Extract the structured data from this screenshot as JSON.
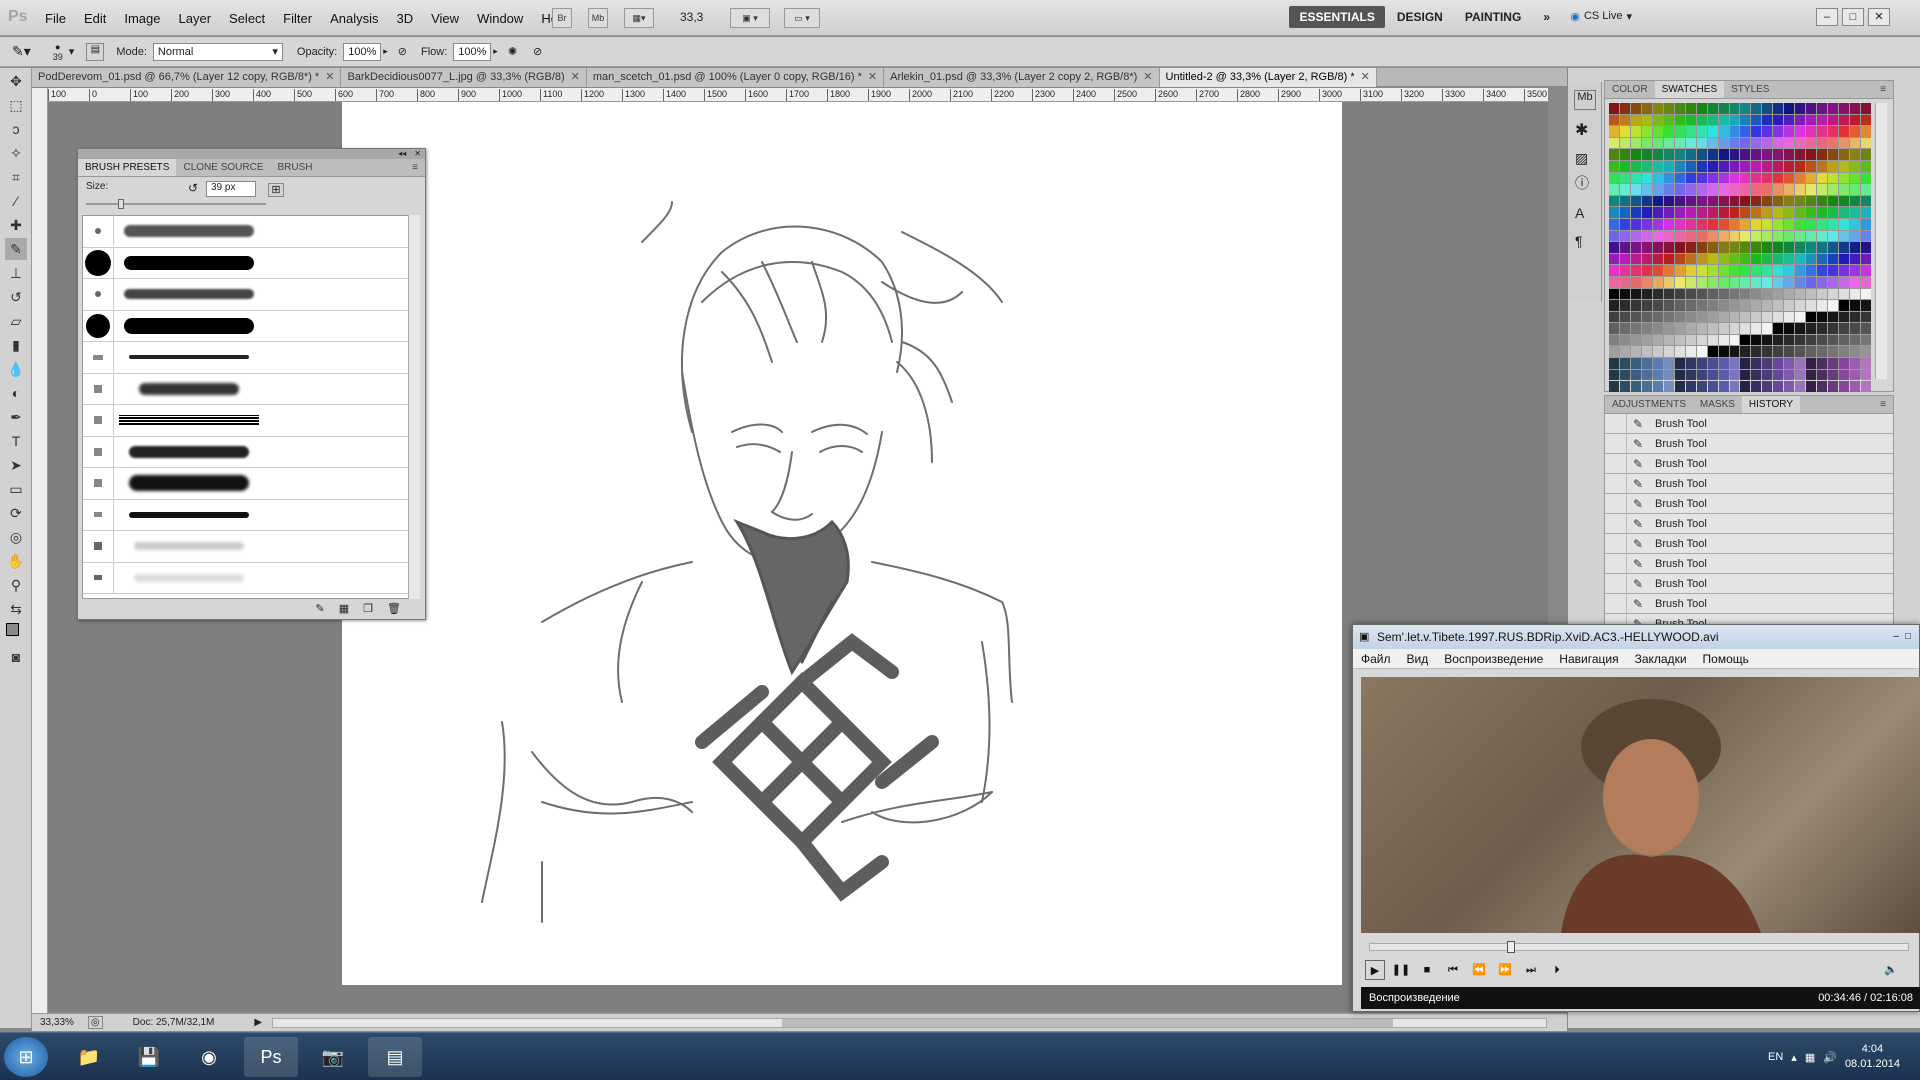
{
  "app": {
    "logo": "Ps"
  },
  "menu": [
    "File",
    "Edit",
    "Image",
    "Layer",
    "Select",
    "Filter",
    "Analysis",
    "3D",
    "View",
    "Window",
    "Help"
  ],
  "menubar_buttons": {
    "bridge": "Br",
    "minibridge": "Mb",
    "zoom": "33,3"
  },
  "workspaces": [
    "ESSENTIALS",
    "DESIGN",
    "PAINTING"
  ],
  "cs_live": "CS Live",
  "options": {
    "brush_size": "39",
    "mode_label": "Mode:",
    "mode_value": "Normal",
    "opacity_label": "Opacity:",
    "opacity_value": "100%",
    "flow_label": "Flow:",
    "flow_value": "100%"
  },
  "doc_tabs": [
    {
      "label": "PodDerevom_01.psd @ 66,7% (Layer 12 copy, RGB/8*) *"
    },
    {
      "label": "BarkDecidious0077_L.jpg @ 33,3% (RGB/8)"
    },
    {
      "label": "man_scetch_01.psd @ 100% (Layer 0 copy, RGB/16) *"
    },
    {
      "label": "Arlekin_01.psd @ 33,3% (Layer 2 copy 2, RGB/8*)"
    },
    {
      "label": "Untitled-2 @ 33,3% (Layer 2, RGB/8) *"
    }
  ],
  "ruler_ticks": [
    "100",
    "0",
    "100",
    "200",
    "300",
    "400",
    "500",
    "600",
    "700",
    "800",
    "900",
    "1000",
    "1100",
    "1200",
    "1300",
    "1400",
    "1500",
    "1600",
    "1700",
    "1800",
    "1900",
    "2000",
    "2100",
    "2200",
    "2300",
    "2400",
    "2500",
    "2600",
    "2700",
    "2800",
    "2900",
    "3000",
    "3100",
    "3200",
    "3300",
    "3400",
    "3500"
  ],
  "status": {
    "zoom": "33,33%",
    "doc": "Doc: 25,7M/32,1M"
  },
  "brush_panel": {
    "tabs": [
      "BRUSH PRESETS",
      "CLONE SOURCE",
      "BRUSH"
    ],
    "size_label": "Size:",
    "size_value": "39 px"
  },
  "swatch_panel": {
    "tabs": [
      "COLOR",
      "SWATCHES",
      "STYLES"
    ]
  },
  "history_panel": {
    "tabs": [
      "ADJUSTMENTS",
      "MASKS",
      "HISTORY"
    ],
    "items": [
      "Brush Tool",
      "Brush Tool",
      "Brush Tool",
      "Brush Tool",
      "Brush Tool",
      "Brush Tool",
      "Brush Tool",
      "Brush Tool",
      "Brush Tool",
      "Brush Tool",
      "Brush Tool"
    ]
  },
  "player": {
    "title": "Sem'.let.v.Tibete.1997.RUS.BDRip.XviD.AC3.-HELLYWOOD.avi",
    "menu": [
      "Файл",
      "Вид",
      "Воспроизведение",
      "Навигация",
      "Закладки",
      "Помощь"
    ],
    "status": "Воспроизведение",
    "time": "00:34:46 / 02:16:08",
    "progress": 0.255
  },
  "taskbar": {
    "lang": "EN",
    "time": "4:04",
    "date": "08.01.2014"
  },
  "colors": {
    "workspace_active": "#555555",
    "canvas_bg": "#7f7f7f",
    "taskbar": "#1c3250"
  }
}
